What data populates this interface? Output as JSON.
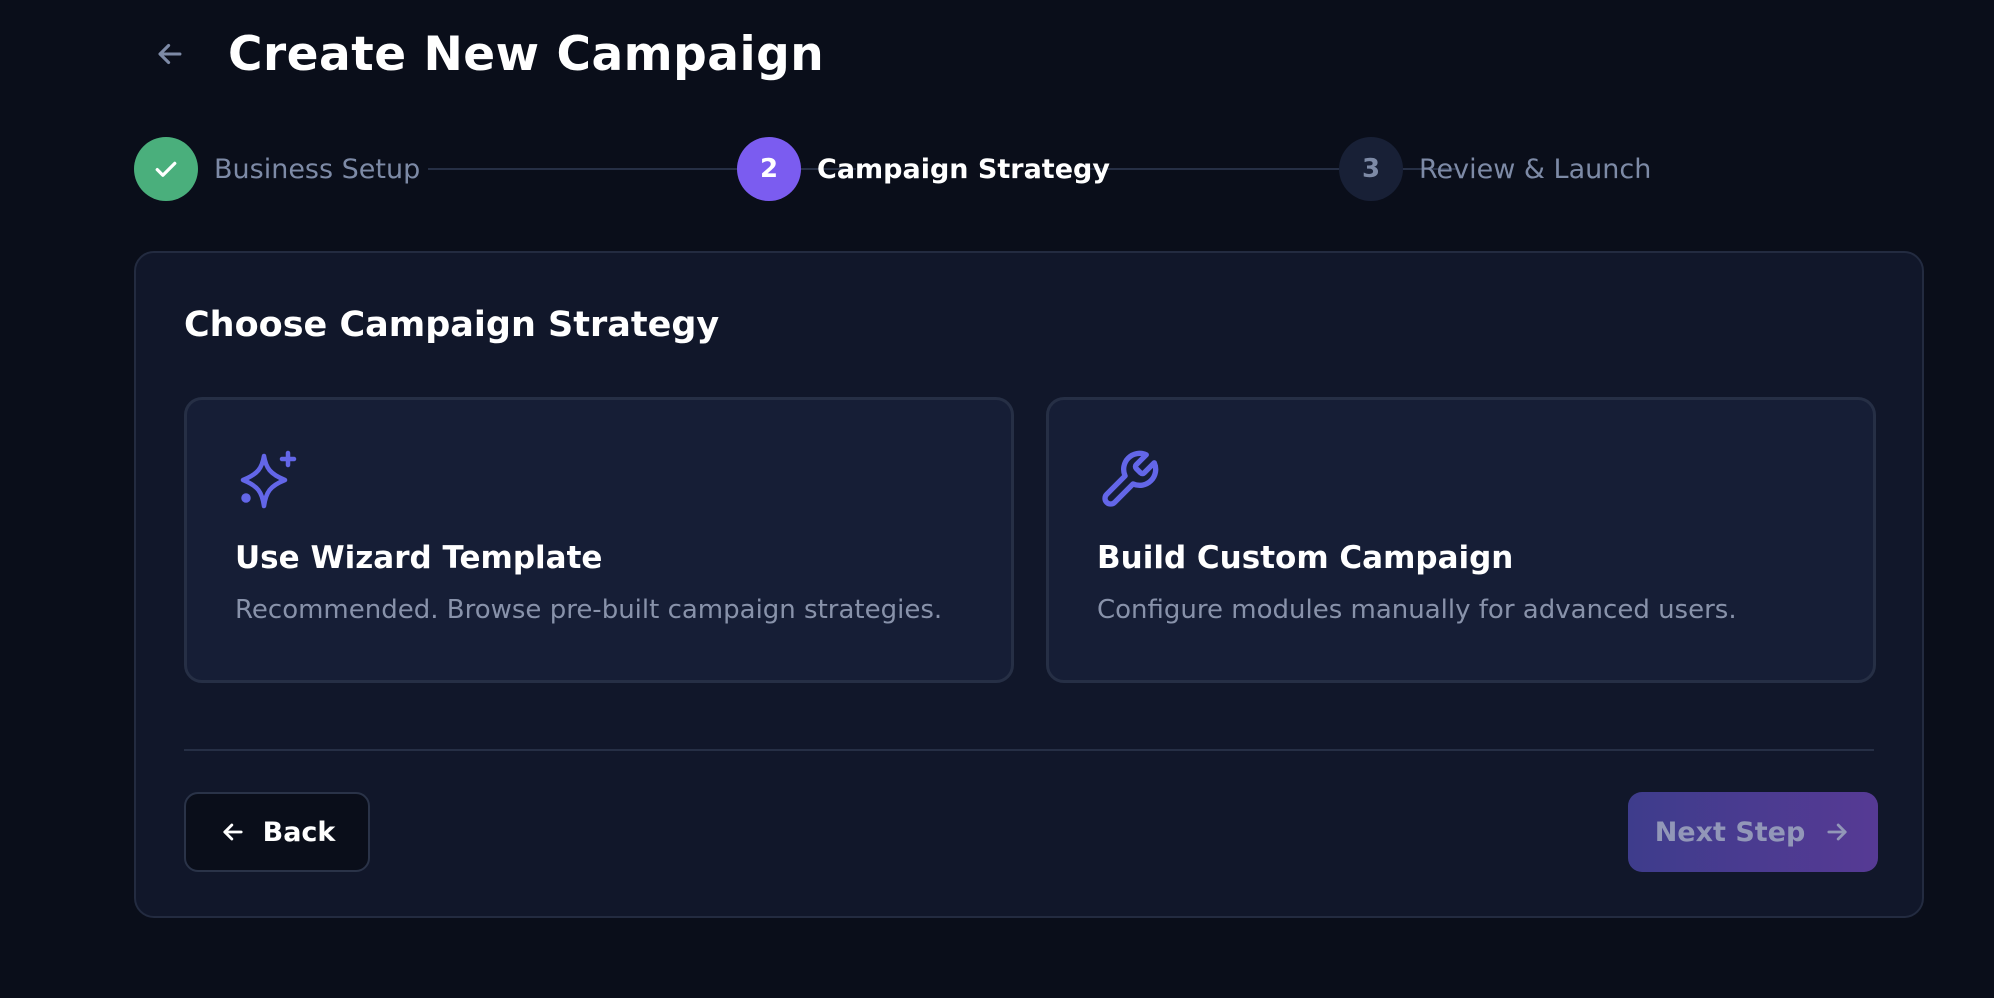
{
  "header": {
    "title": "Create New Campaign",
    "back_icon": "arrow-left-icon"
  },
  "stepper": {
    "steps": [
      {
        "label": "Business Setup",
        "status": "completed",
        "marker": "check-icon"
      },
      {
        "label": "Campaign Strategy",
        "status": "current",
        "marker": "2"
      },
      {
        "label": "Review & Launch",
        "status": "upcoming",
        "marker": "3"
      }
    ]
  },
  "card": {
    "title": "Choose Campaign Strategy",
    "options": [
      {
        "icon": "sparkles-icon",
        "title": "Use Wizard Template",
        "description": "Recommended. Browse pre-built campaign strategies."
      },
      {
        "icon": "wrench-icon",
        "title": "Build Custom Campaign",
        "description": "Configure modules manually for advanced users."
      }
    ],
    "back_button": {
      "label": "Back",
      "icon": "arrow-left-icon"
    },
    "next_button": {
      "label": "Next Step",
      "icon": "arrow-right-icon",
      "state": "disabled"
    }
  },
  "colors": {
    "background": "#0a0e1a",
    "card": "#11172a",
    "accent": "#7b5cf0",
    "success": "#4aaf7c",
    "icon_accent": "#6366e8"
  }
}
